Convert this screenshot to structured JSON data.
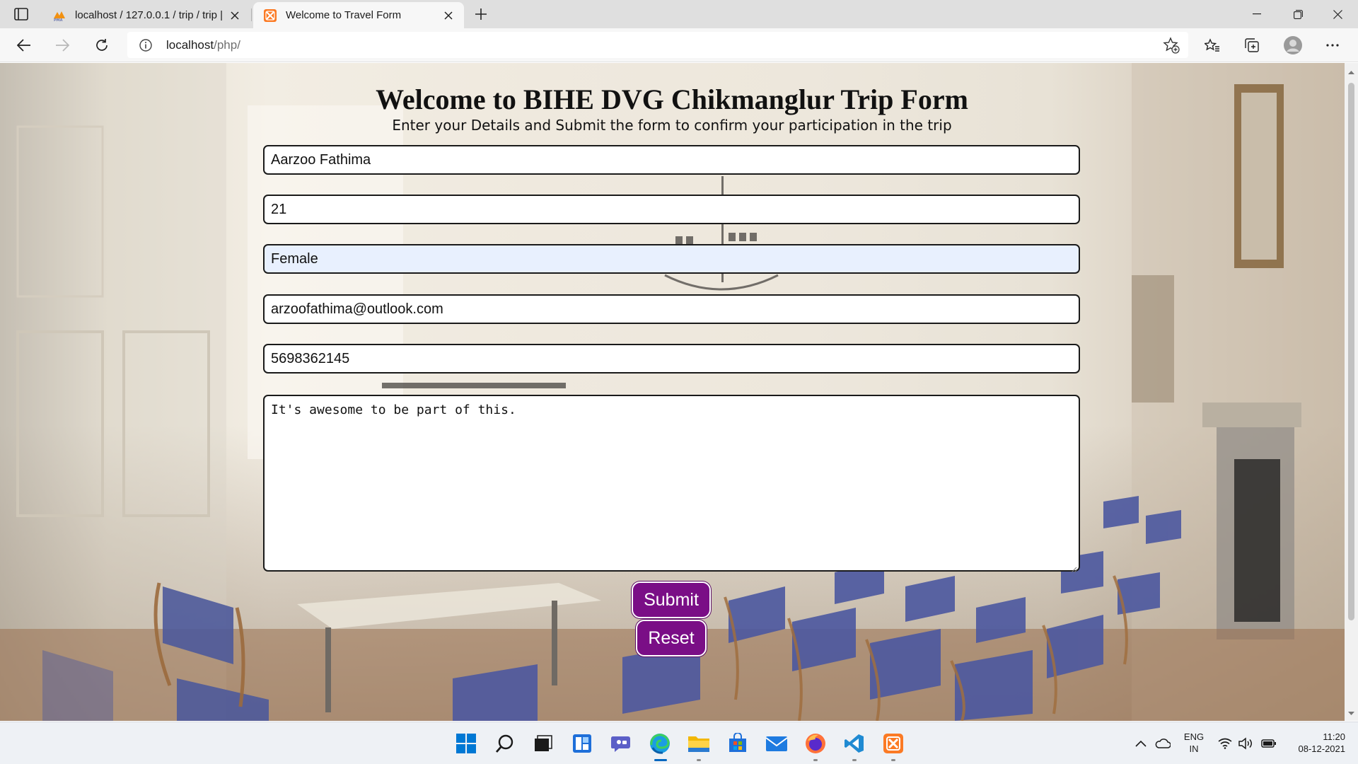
{
  "browser": {
    "tabs": [
      {
        "title": "localhost / 127.0.0.1 / trip / trip |",
        "favicon": "phpmyadmin-icon",
        "active": false
      },
      {
        "title": "Welcome to Travel Form",
        "favicon": "xampp-icon",
        "active": true
      }
    ],
    "address": {
      "host": "localhost",
      "path": "/php/"
    }
  },
  "page": {
    "title": "Welcome to BIHE DVG Chikmanglur Trip Form",
    "subtitle": "Enter your Details and Submit the form to confirm your participation in the trip",
    "form": {
      "name": "Aarzoo Fathima",
      "age": "21",
      "gender": "Female",
      "email": "arzoofathima@outlook.com",
      "phone": "5698362145",
      "other_info": "It's awesome to be part of this.",
      "submit_label": "Submit",
      "reset_label": "Reset"
    },
    "accent_color": "#7a0e86"
  },
  "taskbar": {
    "apps": [
      "windows-start-icon",
      "search-icon",
      "task-view-icon",
      "widgets-icon",
      "teams-chat-icon",
      "edge-icon",
      "file-explorer-icon",
      "microsoft-store-icon",
      "mail-icon",
      "firefox-icon",
      "vscode-icon",
      "xampp-icon"
    ],
    "language": {
      "line1": "ENG",
      "line2": "IN"
    },
    "clock": {
      "time": "11:20",
      "date": "08-12-2021"
    }
  }
}
